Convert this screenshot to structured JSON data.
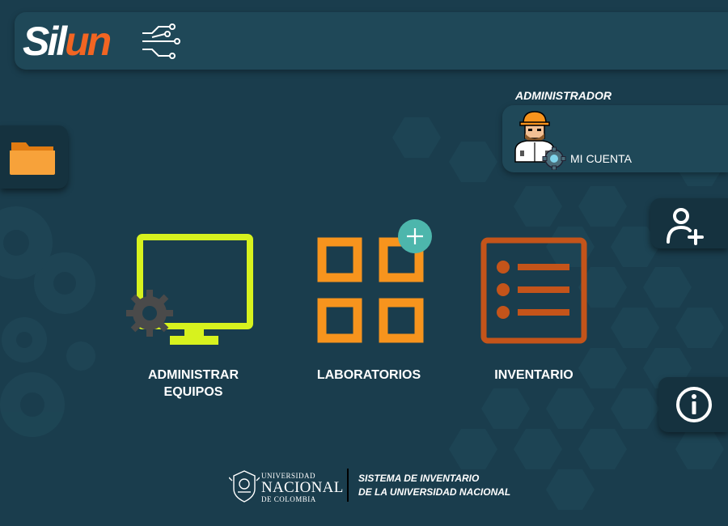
{
  "app": {
    "logo_text_white": "Sil",
    "logo_text_orange": "un"
  },
  "account": {
    "role": "ADMINISTRADOR",
    "label": "MI CUENTA"
  },
  "tiles": [
    {
      "label": "ADMINISTRAR\nEQUIPOS",
      "icon": "monitor-gear-icon"
    },
    {
      "label": "LABORATORIOS",
      "icon": "grid-add-icon"
    },
    {
      "label": "INVENTARIO",
      "icon": "list-icon"
    }
  ],
  "side_buttons": {
    "left": "folder-icon",
    "add_user": "add-user-icon",
    "info": "info-icon"
  },
  "footer": {
    "university_top": "UNIVERSIDAD",
    "university_middle": "NACIONAL",
    "university_bottom": "DE COLOMBIA",
    "system_line1": "SISTEMA DE INVENTARIO",
    "system_line2": "DE LA UNIVERSIDAD NACIONAL"
  },
  "colors": {
    "background": "#1a3d4d",
    "panel": "#1f4858",
    "accent_orange": "#f26522",
    "monitor_green": "#d7f21e",
    "grid_orange": "#f7941d",
    "list_orange": "#c4541a",
    "add_teal": "#4db6ac"
  }
}
